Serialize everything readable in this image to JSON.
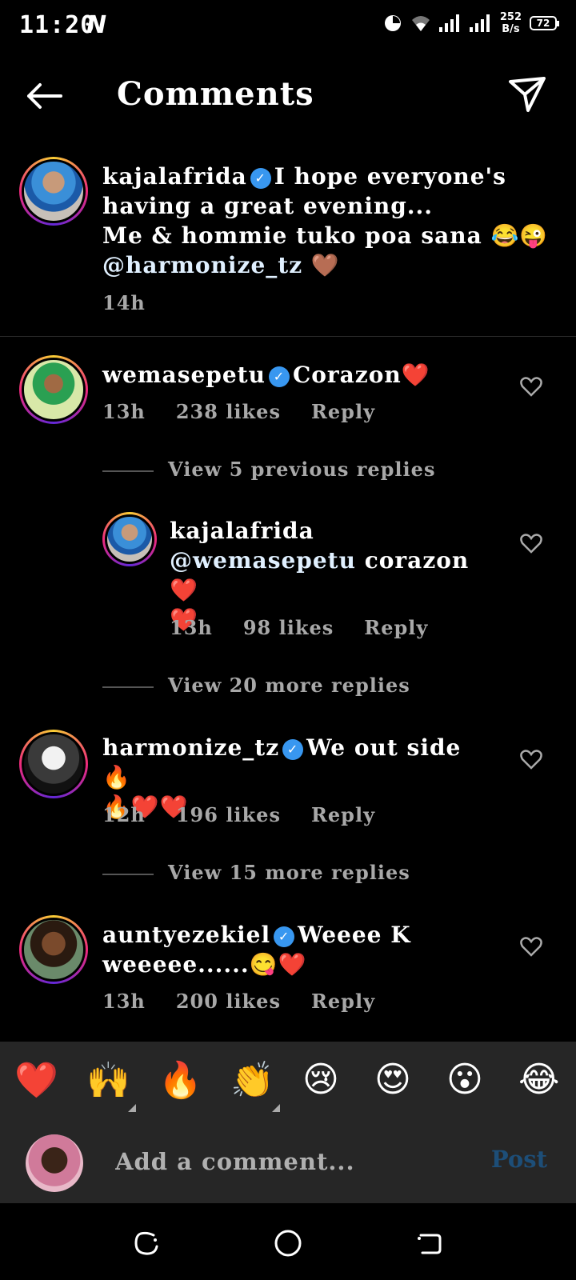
{
  "status_bar": {
    "time": "11:20",
    "carrier_icon": "N",
    "speed_value": "252",
    "speed_unit": "B/s",
    "battery": "72"
  },
  "header": {
    "title": "Comments"
  },
  "caption": {
    "username": "kajalafrida",
    "text_line1": "I hope everyone's",
    "text_line2": "having a great evening...",
    "text_line3": "Me & hommie tuko poa sana 😂😜",
    "mention": "@harmonize_tz",
    "mention_emoji": "🤎",
    "time": "14h"
  },
  "comments": [
    {
      "username": "wemasepetu",
      "text": "Corazon❤️",
      "time": "13h",
      "likes": "238 likes",
      "reply": "Reply"
    },
    {
      "username": "harmonize_tz",
      "text": "We out side 🔥",
      "text2": "🔥❤️❤️",
      "time": "12h",
      "likes": "196 likes",
      "reply": "Reply"
    },
    {
      "username": "auntyezekiel",
      "text": "Weeee K",
      "text2": "weeeee......😋❤️",
      "time": "13h",
      "likes": "200 likes",
      "reply": "Reply"
    }
  ],
  "reply": {
    "username": "kajalafrida",
    "mention": "@wemasepetu",
    "text": " corazon ❤️",
    "text2": "❤️",
    "time": "13h",
    "likes": "98 likes",
    "reply": "Reply"
  },
  "view_links": {
    "previous": "View 5 previous replies",
    "more1": "View 20 more replies",
    "more2": "View 15 more replies"
  },
  "emojis": [
    "❤️",
    "🙌",
    "🔥",
    "👏",
    "😢",
    "😍",
    "😮",
    "😂"
  ],
  "input": {
    "placeholder": "Add a comment...",
    "post": "Post"
  },
  "colors": {
    "verified": "#3897f0",
    "post_disabled": "#1d4e78",
    "meta": "#a8a8a8"
  }
}
